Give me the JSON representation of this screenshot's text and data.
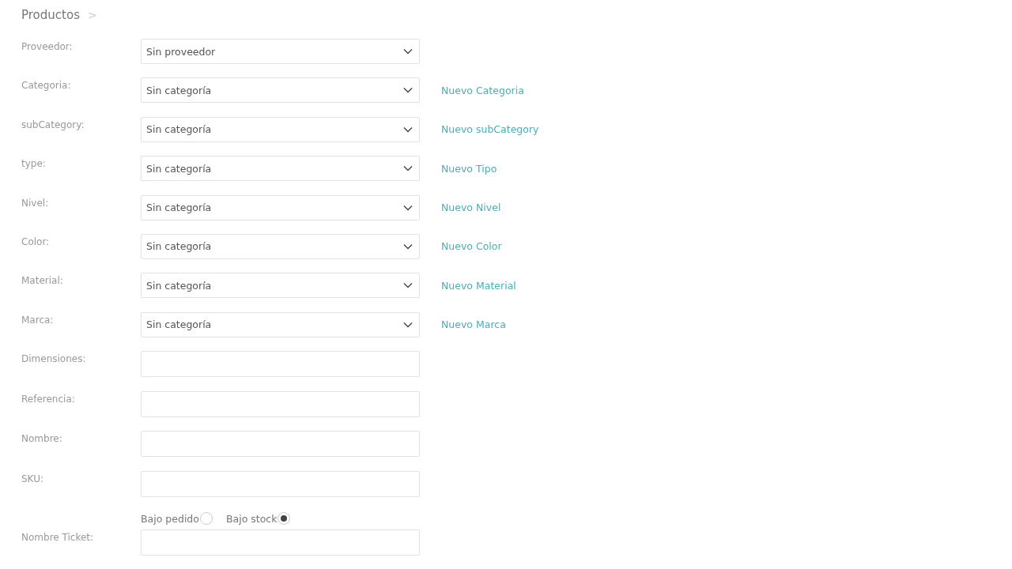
{
  "breadcrumb": {
    "title": "Productos",
    "separator": ">"
  },
  "rows": [
    {
      "kind": "select",
      "label": "Proveedor:",
      "value": "Sin proveedor"
    },
    {
      "kind": "select",
      "label": "Categoria:",
      "value": "Sin categoría",
      "link": "Nuevo Categoria"
    },
    {
      "kind": "select",
      "label": "subCategory:",
      "value": "Sin categoría",
      "link": "Nuevo subCategory"
    },
    {
      "kind": "select",
      "label": "type:",
      "value": "Sin categoría",
      "link": "Nuevo Tipo"
    },
    {
      "kind": "select",
      "label": "Nivel:",
      "value": "Sin categoría",
      "link": "Nuevo Nivel"
    },
    {
      "kind": "select",
      "label": "Color:",
      "value": "Sin categoría",
      "link": "Nuevo Color"
    },
    {
      "kind": "select",
      "label": "Material:",
      "value": "Sin categoría",
      "link": "Nuevo Material"
    },
    {
      "kind": "select",
      "label": "Marca:",
      "value": "Sin categoría",
      "link": "Nuevo Marca"
    },
    {
      "kind": "text",
      "label": "Dimensiones:"
    },
    {
      "kind": "text",
      "label": "Referencia:"
    },
    {
      "kind": "text",
      "label": "Nombre:"
    },
    {
      "kind": "text",
      "label": "SKU:"
    },
    {
      "kind": "radio",
      "options": [
        {
          "label": "Bajo pedido",
          "selected": false
        },
        {
          "label": "Bajo stock",
          "selected": true
        }
      ]
    },
    {
      "kind": "text",
      "label": "Nombre Ticket:"
    }
  ]
}
